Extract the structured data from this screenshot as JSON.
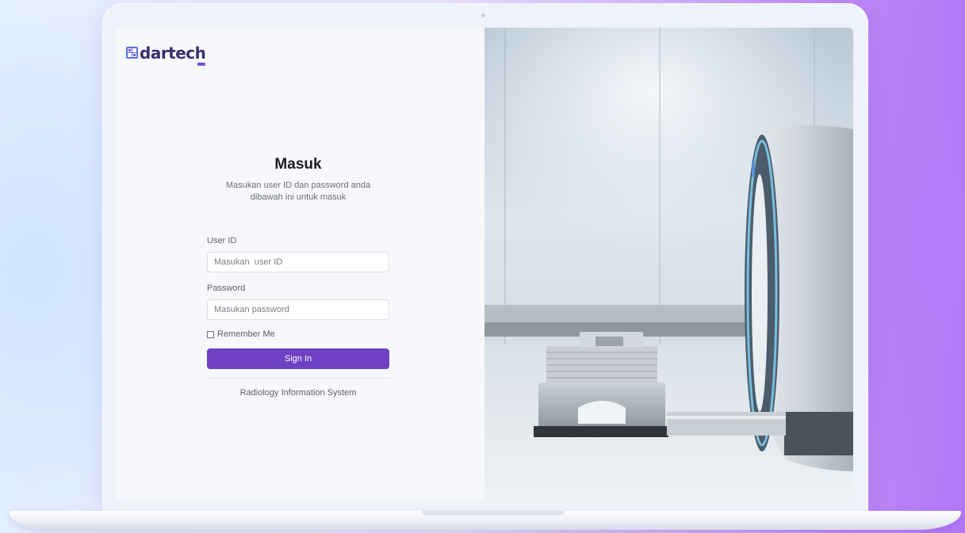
{
  "brand": {
    "name": "dartech",
    "logo_icon": "dartech-logo-mark",
    "accent_color": "#6e40c4"
  },
  "login": {
    "title": "Masuk",
    "subtitle": "Masukan user ID dan password anda dibawah ini untuk masuk",
    "user_id_label": "User ID",
    "user_id_placeholder": "Masukan  user ID",
    "user_id_value": "",
    "password_label": "Password",
    "password_placeholder": "Masukan password",
    "password_value": "",
    "remember_label": "Remember Me",
    "remember_checked": false,
    "submit_label": "Sign In",
    "footer": "Radiology Information System"
  },
  "hero": {
    "image": "ct-scanner-room-photo"
  }
}
